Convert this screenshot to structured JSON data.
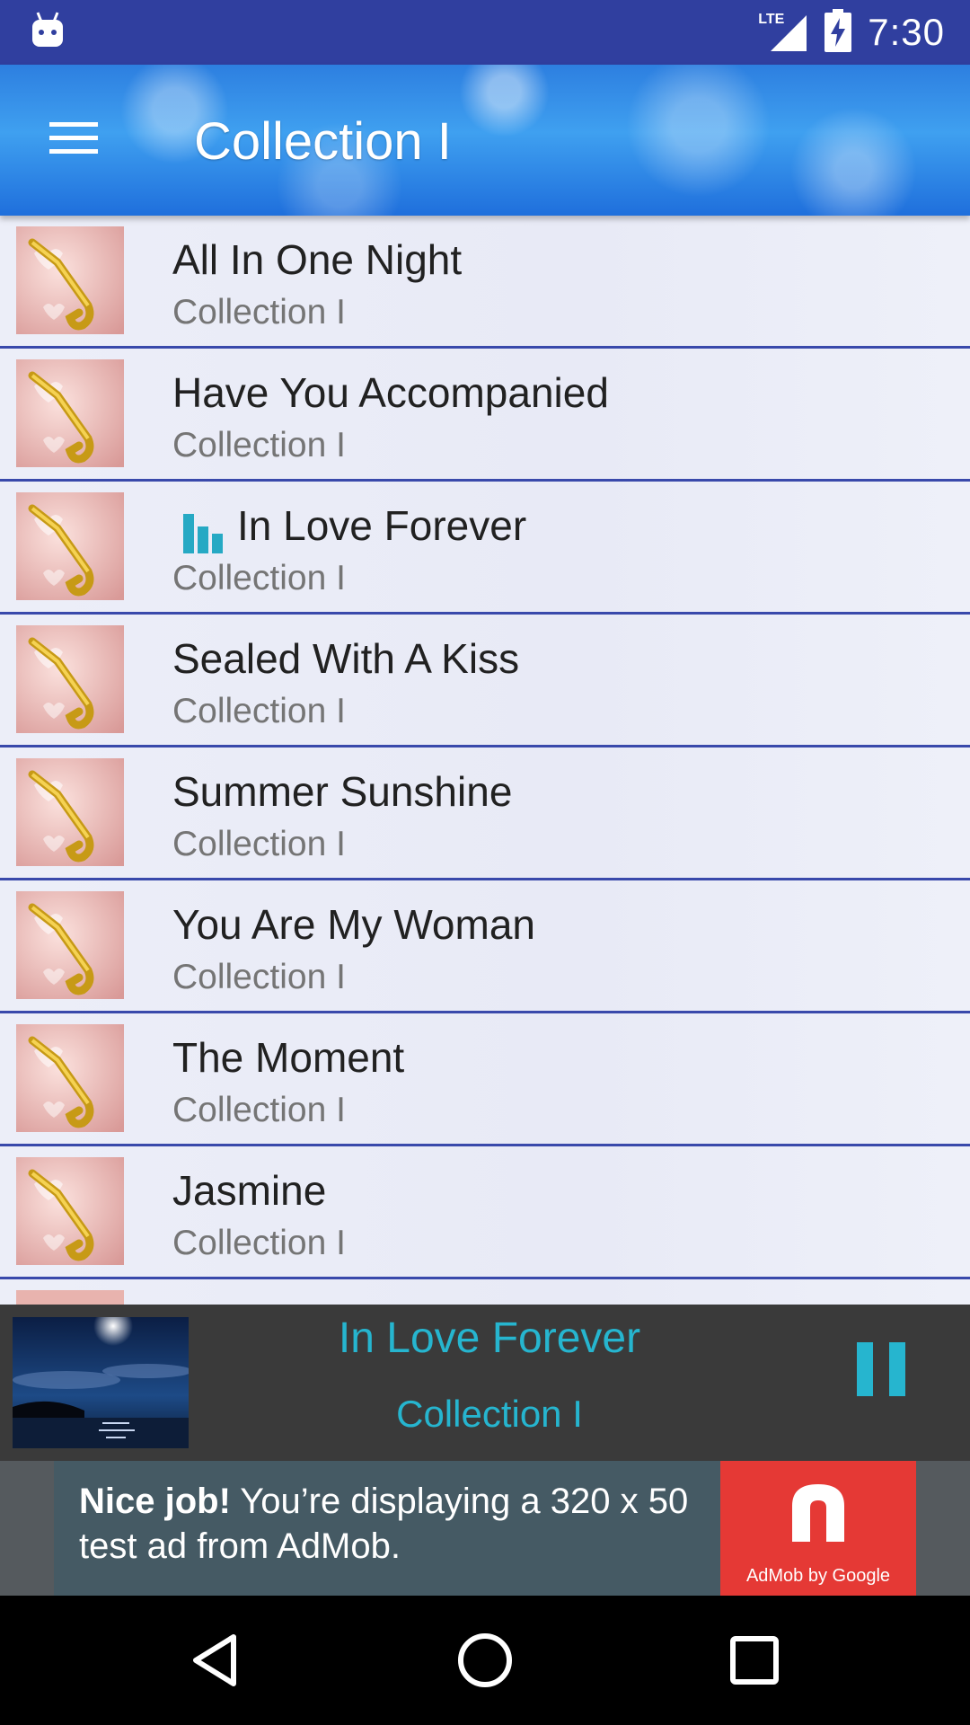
{
  "status_bar": {
    "time": "7:30",
    "network": "LTE"
  },
  "toolbar": {
    "title": "Collection I"
  },
  "songs": [
    {
      "title": "All In One Night",
      "album": "Collection I"
    },
    {
      "title": "Have You Accompanied",
      "album": "Collection I"
    },
    {
      "title": "In Love Forever",
      "album": "Collection I",
      "playing": true
    },
    {
      "title": "Sealed With A Kiss",
      "album": "Collection I"
    },
    {
      "title": "Summer Sunshine",
      "album": "Collection I"
    },
    {
      "title": "You Are My Woman",
      "album": "Collection I"
    },
    {
      "title": "The Moment",
      "album": "Collection I"
    },
    {
      "title": "Jasmine",
      "album": "Collection I"
    }
  ],
  "now_playing": {
    "title": "In Love Forever",
    "album": "Collection I"
  },
  "ad": {
    "headline": "Nice job!",
    "body": " You’re displaying a 320 x 50 test ad from AdMob.",
    "logo_caption": "AdMob by Google"
  },
  "colors": {
    "status_bar": "#303f9f",
    "divider": "#3949ab",
    "accent": "#26b5cf",
    "player_bg": "#3a3a3a",
    "ad_red": "#e53935"
  }
}
